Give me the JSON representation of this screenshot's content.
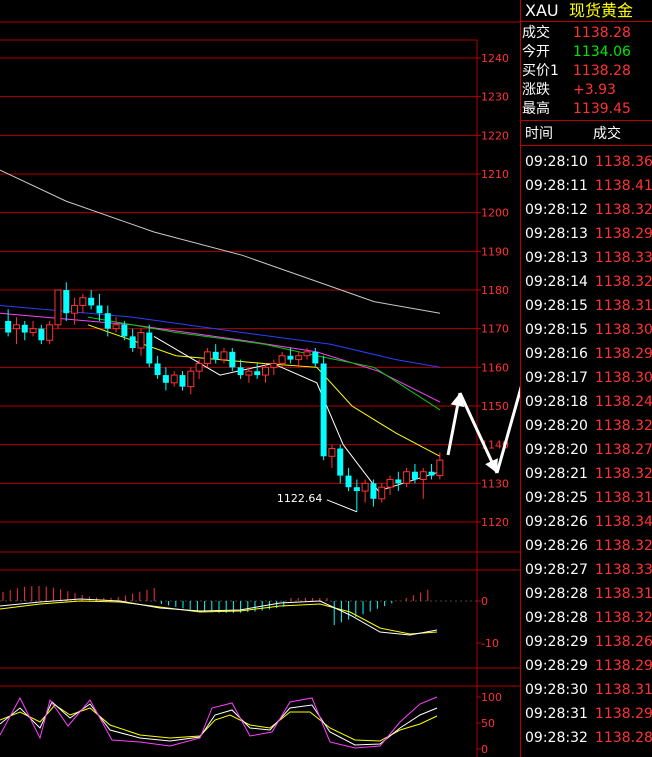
{
  "header": {
    "symbol": "XAU",
    "name": "现货黄金"
  },
  "quote": [
    {
      "label": "成交",
      "value": "1138.28",
      "color": "red"
    },
    {
      "label": "今开",
      "value": "1134.06",
      "color": "green"
    },
    {
      "label": "买价1",
      "value": "1138.28",
      "color": "red"
    },
    {
      "label": "涨跌",
      "value": "+3.93",
      "color": "red"
    },
    {
      "label": "最高",
      "value": "1139.45",
      "color": "red"
    }
  ],
  "ticks_header": {
    "time": "时间",
    "price": "成交"
  },
  "ticks": [
    {
      "time": "09:28:10",
      "price": "1138.36"
    },
    {
      "time": "09:28:11",
      "price": "1138.41"
    },
    {
      "time": "09:28:12",
      "price": "1138.32"
    },
    {
      "time": "09:28:13",
      "price": "1138.29"
    },
    {
      "time": "09:28:13",
      "price": "1138.33"
    },
    {
      "time": "09:28:14",
      "price": "1138.32"
    },
    {
      "time": "09:28:15",
      "price": "1138.31"
    },
    {
      "time": "09:28:15",
      "price": "1138.30"
    },
    {
      "time": "09:28:16",
      "price": "1138.29"
    },
    {
      "time": "09:28:17",
      "price": "1138.30"
    },
    {
      "time": "09:28:18",
      "price": "1138.24"
    },
    {
      "time": "09:28:20",
      "price": "1138.32"
    },
    {
      "time": "09:28:20",
      "price": "1138.27"
    },
    {
      "time": "09:28:21",
      "price": "1138.32"
    },
    {
      "time": "09:28:25",
      "price": "1138.31"
    },
    {
      "time": "09:28:26",
      "price": "1138.34"
    },
    {
      "time": "09:28:26",
      "price": "1138.32"
    },
    {
      "time": "09:28:27",
      "price": "1138.33"
    },
    {
      "time": "09:28:28",
      "price": "1138.31"
    },
    {
      "time": "09:28:28",
      "price": "1138.32"
    },
    {
      "time": "09:28:29",
      "price": "1138.26"
    },
    {
      "time": "09:28:29",
      "price": "1138.29"
    },
    {
      "time": "09:28:30",
      "price": "1138.31"
    },
    {
      "time": "09:28:31",
      "price": "1138.29"
    },
    {
      "time": "09:28:32",
      "price": "1138.28"
    }
  ],
  "price_axis": {
    "labels": [
      "1240",
      "1230",
      "1220",
      "1210",
      "1200",
      "1190",
      "1180",
      "1170",
      "1160",
      "1150",
      "1140",
      "1130",
      "1120"
    ]
  },
  "macd_axis": {
    "labels": [
      "0",
      "-10"
    ]
  },
  "kdj_axis": {
    "labels": [
      "100",
      "50",
      "0"
    ]
  },
  "low_annotation": "1122.64",
  "colors": {
    "up": "#ff3232",
    "down": "#00ffff",
    "grid": "#b00000",
    "axis_text": "#ff3232"
  },
  "chart_data": {
    "type": "candlestick",
    "ylim": [
      1117,
      1245
    ],
    "candles": [
      {
        "o": 1172,
        "h": 1175,
        "l": 1168,
        "c": 1169
      },
      {
        "o": 1170,
        "h": 1173,
        "l": 1166,
        "c": 1171
      },
      {
        "o": 1171,
        "h": 1172,
        "l": 1167,
        "c": 1169
      },
      {
        "o": 1169,
        "h": 1172,
        "l": 1168,
        "c": 1170
      },
      {
        "o": 1170,
        "h": 1171,
        "l": 1166,
        "c": 1167
      },
      {
        "o": 1167,
        "h": 1172,
        "l": 1166,
        "c": 1171
      },
      {
        "o": 1171,
        "h": 1180,
        "l": 1170,
        "c": 1180
      },
      {
        "o": 1180,
        "h": 1182,
        "l": 1172,
        "c": 1174
      },
      {
        "o": 1174,
        "h": 1178,
        "l": 1171,
        "c": 1176
      },
      {
        "o": 1176,
        "h": 1179,
        "l": 1174,
        "c": 1178
      },
      {
        "o": 1178,
        "h": 1180,
        "l": 1175,
        "c": 1176
      },
      {
        "o": 1176,
        "h": 1179,
        "l": 1172,
        "c": 1174
      },
      {
        "o": 1174,
        "h": 1176,
        "l": 1168,
        "c": 1170
      },
      {
        "o": 1170,
        "h": 1173,
        "l": 1169,
        "c": 1171
      },
      {
        "o": 1171,
        "h": 1172,
        "l": 1167,
        "c": 1168
      },
      {
        "o": 1168,
        "h": 1170,
        "l": 1164,
        "c": 1165
      },
      {
        "o": 1165,
        "h": 1170,
        "l": 1163,
        "c": 1169
      },
      {
        "o": 1169,
        "h": 1171,
        "l": 1160,
        "c": 1161
      },
      {
        "o": 1161,
        "h": 1163,
        "l": 1157,
        "c": 1158
      },
      {
        "o": 1158,
        "h": 1160,
        "l": 1154,
        "c": 1156
      },
      {
        "o": 1156,
        "h": 1159,
        "l": 1155,
        "c": 1158
      },
      {
        "o": 1158,
        "h": 1159,
        "l": 1154,
        "c": 1155
      },
      {
        "o": 1155,
        "h": 1160,
        "l": 1153,
        "c": 1159
      },
      {
        "o": 1159,
        "h": 1162,
        "l": 1157,
        "c": 1161
      },
      {
        "o": 1161,
        "h": 1165,
        "l": 1160,
        "c": 1164
      },
      {
        "o": 1164,
        "h": 1166,
        "l": 1161,
        "c": 1162
      },
      {
        "o": 1162,
        "h": 1165,
        "l": 1161,
        "c": 1164
      },
      {
        "o": 1164,
        "h": 1165,
        "l": 1159,
        "c": 1160
      },
      {
        "o": 1160,
        "h": 1162,
        "l": 1157,
        "c": 1158
      },
      {
        "o": 1158,
        "h": 1160,
        "l": 1156,
        "c": 1159
      },
      {
        "o": 1159,
        "h": 1161,
        "l": 1157,
        "c": 1158
      },
      {
        "o": 1158,
        "h": 1161,
        "l": 1156,
        "c": 1160
      },
      {
        "o": 1160,
        "h": 1162,
        "l": 1158,
        "c": 1161
      },
      {
        "o": 1161,
        "h": 1164,
        "l": 1160,
        "c": 1163
      },
      {
        "o": 1163,
        "h": 1165,
        "l": 1161,
        "c": 1162
      },
      {
        "o": 1162,
        "h": 1164,
        "l": 1160,
        "c": 1163
      },
      {
        "o": 1163,
        "h": 1165,
        "l": 1162,
        "c": 1164
      },
      {
        "o": 1164,
        "h": 1165,
        "l": 1160,
        "c": 1161
      },
      {
        "o": 1161,
        "h": 1163,
        "l": 1136,
        "c": 1137
      },
      {
        "o": 1137,
        "h": 1140,
        "l": 1134,
        "c": 1139
      },
      {
        "o": 1139,
        "h": 1140,
        "l": 1130,
        "c": 1132
      },
      {
        "o": 1132,
        "h": 1134,
        "l": 1128,
        "c": 1129
      },
      {
        "o": 1129,
        "h": 1131,
        "l": 1122.64,
        "c": 1128
      },
      {
        "o": 1128,
        "h": 1131,
        "l": 1125,
        "c": 1130
      },
      {
        "o": 1130,
        "h": 1131,
        "l": 1124,
        "c": 1126
      },
      {
        "o": 1126,
        "h": 1130,
        "l": 1125,
        "c": 1129
      },
      {
        "o": 1129,
        "h": 1132,
        "l": 1127,
        "c": 1131
      },
      {
        "o": 1131,
        "h": 1133,
        "l": 1128,
        "c": 1130
      },
      {
        "o": 1130,
        "h": 1134,
        "l": 1129,
        "c": 1133
      },
      {
        "o": 1133,
        "h": 1135,
        "l": 1130,
        "c": 1131
      },
      {
        "o": 1131,
        "h": 1134,
        "l": 1126,
        "c": 1133
      },
      {
        "o": 1133,
        "h": 1135,
        "l": 1131,
        "c": 1132
      },
      {
        "o": 1132,
        "h": 1138,
        "l": 1131,
        "c": 1136
      }
    ],
    "moving_averages": [
      {
        "color": "#c8c8c8",
        "points": [
          [
            0,
            1211
          ],
          [
            0.15,
            1203
          ],
          [
            0.35,
            1195
          ],
          [
            0.55,
            1189
          ],
          [
            0.7,
            1183
          ],
          [
            0.85,
            1177
          ],
          [
            1,
            1174
          ]
        ]
      },
      {
        "color": "#2a40ff",
        "points": [
          [
            0,
            1176
          ],
          [
            0.3,
            1173
          ],
          [
            0.55,
            1169
          ],
          [
            0.75,
            1166
          ],
          [
            0.9,
            1162
          ],
          [
            1,
            1160
          ]
        ]
      },
      {
        "color": "#ff40ff",
        "points": [
          [
            0,
            1174
          ],
          [
            0.3,
            1171
          ],
          [
            0.55,
            1167
          ],
          [
            0.72,
            1164
          ],
          [
            0.86,
            1159
          ],
          [
            1,
            1151
          ]
        ]
      },
      {
        "color": "#00d000",
        "points": [
          [
            0.2,
            1173
          ],
          [
            0.4,
            1169
          ],
          [
            0.6,
            1166
          ],
          [
            0.72,
            1163
          ],
          [
            0.85,
            1160
          ],
          [
            1,
            1149
          ]
        ]
      },
      {
        "color": "#ffff00",
        "points": [
          [
            0.2,
            1171
          ],
          [
            0.4,
            1163
          ],
          [
            0.6,
            1161
          ],
          [
            0.72,
            1160
          ],
          [
            0.8,
            1150
          ],
          [
            0.9,
            1143
          ],
          [
            1,
            1137
          ]
        ]
      },
      {
        "color": "#ffffff",
        "points": [
          [
            0.35,
            1168
          ],
          [
            0.5,
            1158
          ],
          [
            0.62,
            1161
          ],
          [
            0.72,
            1156
          ],
          [
            0.78,
            1140
          ],
          [
            0.86,
            1128
          ],
          [
            1,
            1133
          ]
        ]
      }
    ]
  }
}
